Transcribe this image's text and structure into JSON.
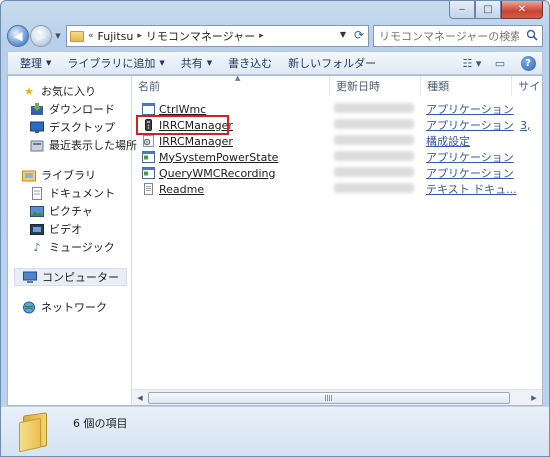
{
  "window": {
    "caption_buttons": [
      "minimize-icon",
      "maximize-icon",
      "close-icon"
    ]
  },
  "address": {
    "crumb_overflow": "«",
    "crumbs": [
      "Fujitsu",
      "リモコンマネージャー"
    ],
    "search_placeholder": "リモコンマネージャーの検索"
  },
  "toolbar": {
    "organize": "整理",
    "add_library": "ライブラリに追加",
    "share": "共有",
    "burn": "書き込む",
    "new_folder": "新しいフォルダー"
  },
  "nav": {
    "favorites": "お気に入り",
    "downloads": "ダウンロード",
    "desktop": "デスクトップ",
    "recent": "最近表示した場所",
    "libraries": "ライブラリ",
    "documents": "ドキュメント",
    "pictures": "ピクチャ",
    "videos": "ビデオ",
    "music": "ミュージック",
    "computer": "コンピューター",
    "network": "ネットワーク"
  },
  "columns": {
    "name": "名前",
    "modified": "更新日時",
    "type": "種類",
    "size": "サイ"
  },
  "files": [
    {
      "name": "CtrlWmc",
      "type": "アプリケーション",
      "size": "",
      "icon": "app-window-icon"
    },
    {
      "name": "IRRCManager",
      "type": "アプリケーション",
      "size": "3,",
      "icon": "remote-control-icon"
    },
    {
      "name": "IRRCManager",
      "type": "構成設定",
      "size": "",
      "icon": "config-gear-icon"
    },
    {
      "name": "MySystemPowerState",
      "type": "アプリケーション",
      "size": "",
      "icon": "app-window-icon"
    },
    {
      "name": "QueryWMCRecording",
      "type": "アプリケーション",
      "size": "",
      "icon": "app-window-icon"
    },
    {
      "name": "Readme",
      "type": "テキスト ドキュ...",
      "size": "",
      "icon": "text-document-icon"
    }
  ],
  "status": {
    "item_count": "6 個の項目"
  },
  "colors": {
    "highlight": "#d42020",
    "link": "#3a5a96"
  }
}
